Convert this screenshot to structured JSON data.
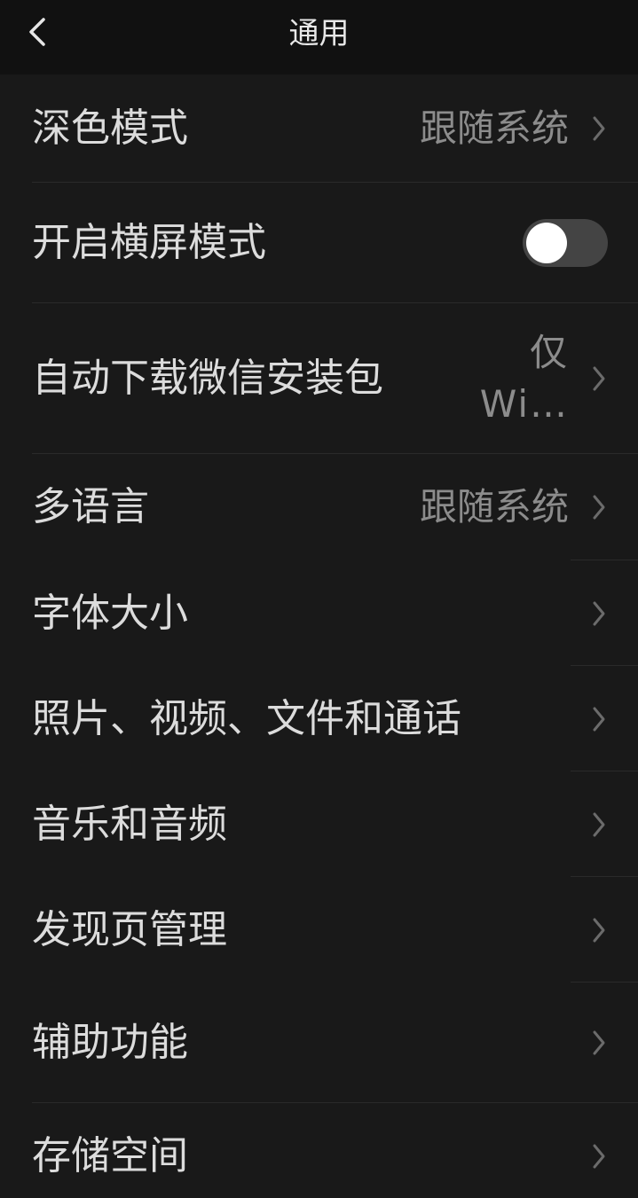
{
  "header": {
    "title": "通用",
    "back_icon": "chevron-left-icon"
  },
  "items": [
    {
      "label": "深色模式",
      "value": "跟随系统"
    },
    {
      "label": "开启横屏模式",
      "toggle_on": false
    },
    {
      "label": "自动下载微信安装包",
      "value": "仅 Wi…"
    },
    {
      "label": "多语言",
      "value": "跟随系统"
    },
    {
      "label": "字体大小"
    },
    {
      "label": "照片、视频、文件和通话"
    },
    {
      "label": "音乐和音频"
    },
    {
      "label": "发现页管理"
    },
    {
      "label": "辅助功能"
    },
    {
      "label": "存储空间"
    }
  ],
  "colors": {
    "background": "#191919",
    "header_bg": "#111111",
    "toggle_off": "#444444"
  }
}
